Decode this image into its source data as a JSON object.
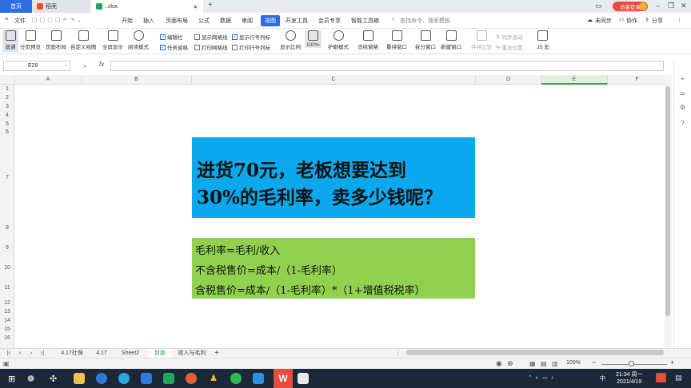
{
  "titlebar": {
    "home_tab": "首页",
    "docer_tab": "稻壳",
    "file_tab": "..xlsx",
    "new_tab": "+",
    "login_button": "访客登录"
  },
  "menu": {
    "file": "文件",
    "items": [
      "开始",
      "插入",
      "页面布局",
      "公式",
      "数据",
      "审阅",
      "视图",
      "开发工具",
      "会员专享",
      "智能工具箱"
    ],
    "search": "查找命令、搜索模板",
    "unsync": "未同步",
    "collab": "协作",
    "share": "分享"
  },
  "ribbon": {
    "normal": "普通",
    "page_break_preview": "分页预览",
    "page_layout": "页面布局",
    "custom_view": "自定义视图",
    "full_screen": "全屏显示",
    "reading_mode": "阅读模式",
    "formula_bar": "编辑栏",
    "task_pane": "任务窗格",
    "show_gridlines": "显示网格线",
    "print_gridlines": "打印网格线",
    "show_headers": "显示行号列标",
    "print_headers": "打印行号列标",
    "zoom": "显示比例",
    "zoom_100": "100%",
    "eye_protection": "护眼模式",
    "freeze_panes": "冻结窗格",
    "rearrange": "重排窗口",
    "split": "拆分窗口",
    "new_window": "新建窗口",
    "side_by_side": "并排比较",
    "sync_scroll": "同步滚动",
    "reset_position": "重设位置",
    "macro": "JS 宏"
  },
  "formula_bar": {
    "name_box": "E28",
    "fx": "fx",
    "value": ""
  },
  "columns": [
    "A",
    "B",
    "C",
    "D",
    "E",
    "F"
  ],
  "rows": [
    "1",
    "2",
    "3",
    "4",
    "5",
    "6",
    "7",
    "8",
    "9",
    "10",
    "11",
    "12",
    "13",
    "14",
    "15",
    "16"
  ],
  "cells": {
    "title_line1": "进货70元，老板想要达到",
    "title_line2": "30%的毛利率，卖多少钱呢？",
    "formula_line1": "毛利率=毛利/收入",
    "formula_line2": "不含税售价=成本/（1-毛利率）",
    "formula_line3": "含税售价=成本/（1-毛利率）*（1+增值税税率）"
  },
  "sheets": [
    "4.17社保",
    "4.17",
    "Sheet2",
    "封面",
    "收入与毛利"
  ],
  "active_sheet": "封面",
  "statusbar": {
    "zoom": "100%",
    "minus": "−",
    "plus": "+"
  },
  "taskbar": {
    "time": "21:34 周一",
    "date": "2021/4/19",
    "ime": "中"
  },
  "colors": {
    "accent": "#2d6de2",
    "box_blue": "#0aa8ec",
    "box_green": "#92d050"
  }
}
